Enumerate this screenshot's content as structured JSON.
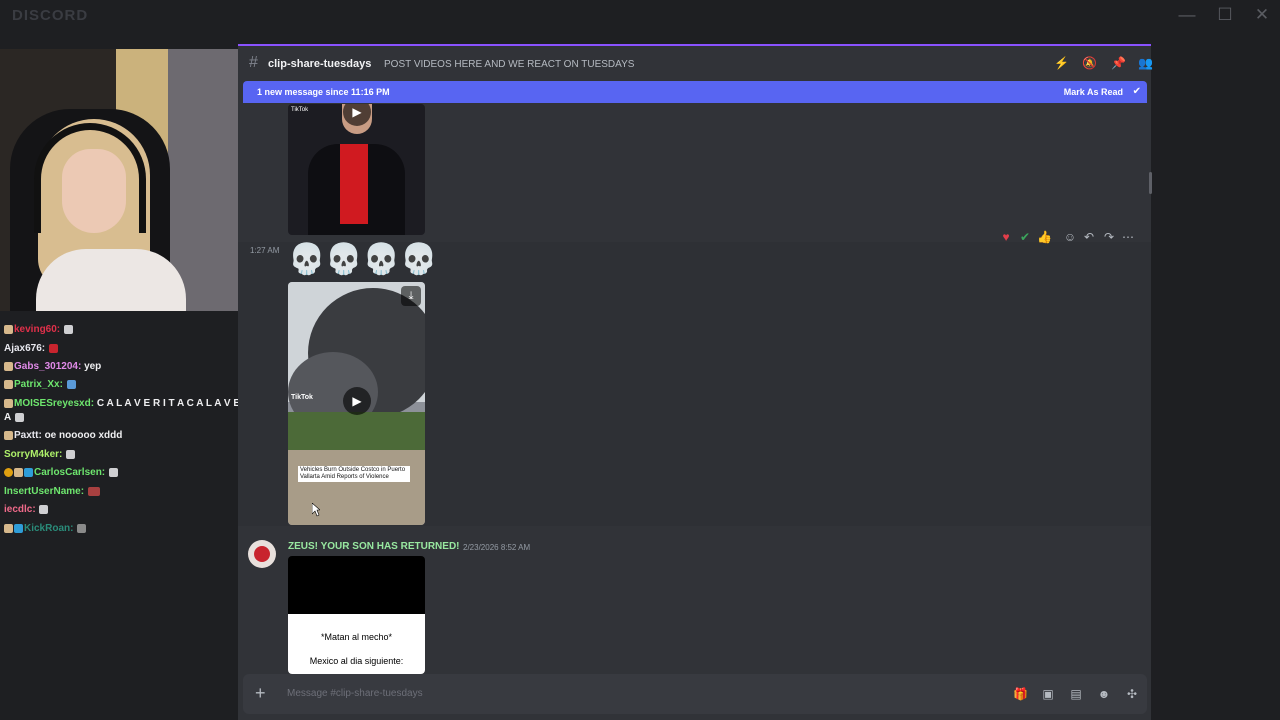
{
  "window": {
    "app_name": "DISCORD",
    "controls": {
      "minimize": "—",
      "maximize": "☐",
      "close": "✕"
    }
  },
  "chat": {
    "lines": [
      {
        "user": "keving60:",
        "color": "#e0304a",
        "message": ""
      },
      {
        "user": "Ajax676:",
        "color": "#e8e8ef",
        "message": ""
      },
      {
        "user": "Gabs_301204:",
        "color": "#e08ae8",
        "message": "yep"
      },
      {
        "user": "Patrix_Xx:",
        "color": "#6ee66e",
        "message": ""
      },
      {
        "user": "MOISESreyesxd:",
        "color": "#6ee66e",
        "message": "C A L A V E R I T A   C A L A V E R I T"
      },
      {
        "user": "A",
        "color": "#efeff1",
        "message": ""
      },
      {
        "user": "Paxtt:",
        "color": "#e8e8ef",
        "message": "oe nooooo xddd"
      },
      {
        "user": "SorryM4ker:",
        "color": "#aef06a",
        "message": ""
      },
      {
        "user": "CarlosCarlsen:",
        "color": "#6ee66e",
        "message": ""
      },
      {
        "user": "InsertUserName:",
        "color": "#6ee66e",
        "message": ""
      },
      {
        "user": "iecdlc:",
        "color": "#f06a8a",
        "message": ""
      },
      {
        "user": "KickRoan:",
        "color": "#2a8c7a",
        "message": ""
      }
    ]
  },
  "channel": {
    "name": "clip-share-tuesdays",
    "topic": "POST VIDEOS HERE AND WE REACT ON TUESDAYS",
    "accent": "#8a52ff"
  },
  "banner": {
    "text": "1 new message since 11:16 PM",
    "action": "Mark As Read",
    "color": "#5865f2"
  },
  "messages": {
    "video1_label": "TikTok",
    "msg2": {
      "time": "1:27 AM",
      "skulls": "💀💀💀💀",
      "video_label": "TikTok",
      "video_caption": "Vehicles Burn Outside Costco in Puerto Vallarta Amid Reports of Violence"
    },
    "msg3": {
      "author": "ZEUS! YOUR SON HAS RETURNED!",
      "date": "2/23/2026 8:52 AM",
      "line1": "*Matan al mecho*",
      "line2": "Mexico al dia siguiente:"
    }
  },
  "composer": {
    "placeholder": "Message #clip-share-tuesdays"
  }
}
